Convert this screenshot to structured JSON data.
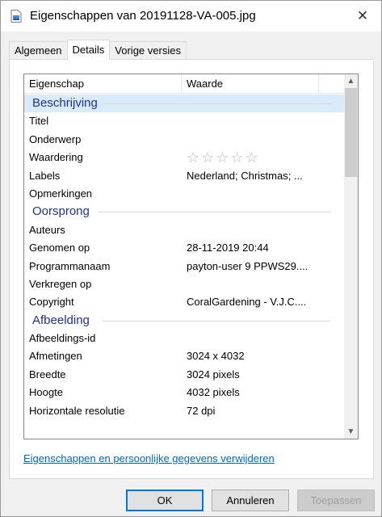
{
  "window": {
    "title": "Eigenschappen van 20191128-VA-005.jpg",
    "icon": "image-file-icon",
    "close_glyph": "✕"
  },
  "tabs": [
    {
      "label": "Algemeen",
      "active": false
    },
    {
      "label": "Details",
      "active": true
    },
    {
      "label": "Vorige versies",
      "active": false
    }
  ],
  "columns": {
    "property": "Eigenschap",
    "value": "Waarde"
  },
  "groups": {
    "description": {
      "name": "Beschrijving",
      "rows": [
        {
          "name": "Titel",
          "value": ""
        },
        {
          "name": "Onderwerp",
          "value": ""
        },
        {
          "name": "Waardering",
          "value": "",
          "rating": 0,
          "rating_max": 5,
          "star_glyph": "☆☆☆☆☆"
        },
        {
          "name": "Labels",
          "value": "Nederland; Christmas; ..."
        },
        {
          "name": "Opmerkingen",
          "value": ""
        }
      ]
    },
    "origin": {
      "name": "Oorsprong",
      "rows": [
        {
          "name": "Auteurs",
          "value": ""
        },
        {
          "name": "Genomen op",
          "value": "28-11-2019 20:44"
        },
        {
          "name": "Programmanaam",
          "value": "payton-user 9 PPWS29...."
        },
        {
          "name": "Verkregen op",
          "value": ""
        },
        {
          "name": "Copyright",
          "value": "CoralGardening - V.J.C...."
        }
      ]
    },
    "image": {
      "name": "Afbeelding",
      "rows": [
        {
          "name": "Afbeeldings-id",
          "value": ""
        },
        {
          "name": "Afmetingen",
          "value": "3024 x 4032"
        },
        {
          "name": "Breedte",
          "value": "3024 pixels"
        },
        {
          "name": "Hoogte",
          "value": "4032 pixels"
        },
        {
          "name": "Horizontale resolutie",
          "value": "72 dpi"
        }
      ]
    }
  },
  "scrollbar": {
    "up_glyph": "▲",
    "down_glyph": "▼"
  },
  "link": {
    "label": "Eigenschappen en persoonlijke gegevens verwijderen"
  },
  "buttons": {
    "ok": "OK",
    "cancel": "Annuleren",
    "apply": "Toepassen"
  },
  "colors": {
    "accent": "#0078d7",
    "group_header": "#1e3287",
    "link": "#0066cc",
    "selected_row": "#d9ebf9"
  }
}
